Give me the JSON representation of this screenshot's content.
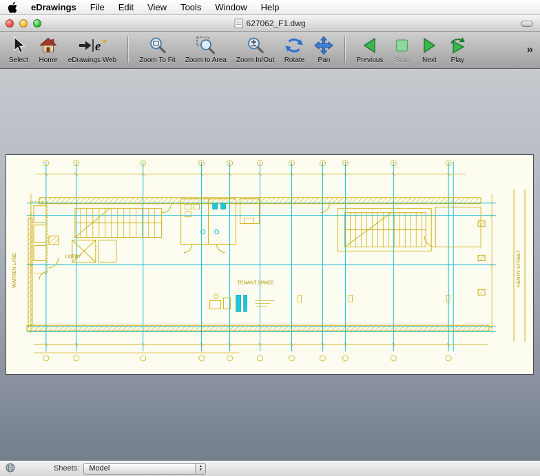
{
  "menubar": {
    "app_name": "eDrawings",
    "items": [
      "File",
      "Edit",
      "View",
      "Tools",
      "Window",
      "Help"
    ]
  },
  "window": {
    "title": "627062_F1.dwg"
  },
  "toolbar": {
    "buttons": [
      {
        "label": "Select"
      },
      {
        "label": "Home"
      },
      {
        "label": "eDrawings Web"
      },
      {
        "label": "Zoom To Fit"
      },
      {
        "label": "Zoom to Area"
      },
      {
        "label": "Zoom In/Out"
      },
      {
        "label": "Rotate"
      },
      {
        "label": "Pan"
      },
      {
        "label": "Previous"
      },
      {
        "label": "Stop",
        "disabled": true
      },
      {
        "label": "Next"
      },
      {
        "label": "Play"
      }
    ],
    "overflow_label": "»"
  },
  "drawing": {
    "labels": {
      "lobby": "LOBBY",
      "tenant_space": "TENANT SPACE",
      "left_street": "WARREN LANE",
      "right_street": "HENRY STREET"
    },
    "colors": {
      "cad_yellow": "#c9a800",
      "cad_cyan": "#00b6d4",
      "paper": "#fdfcf0"
    }
  },
  "statusbar": {
    "sheets_label": "Sheets:",
    "sheet_value": "Model",
    "arrow_up": "▲",
    "arrow_down": "▼"
  }
}
